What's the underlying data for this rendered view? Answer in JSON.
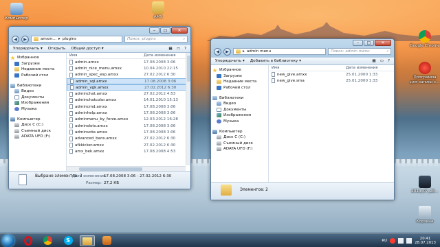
{
  "desktop_icons": [
    {
      "label": "Компьютер"
    },
    {
      "label": "AMX"
    },
    {
      "label": "Google Chrome"
    },
    {
      "label": "Программа для записи с..."
    },
    {
      "label": "2013_07_28..."
    },
    {
      "label": "Корзина"
    }
  ],
  "left_window": {
    "breadcrumb": [
      "amxm...",
      "plugins"
    ],
    "search_placeholder": "Поиск: plugins",
    "toolbar": {
      "organize": "Упорядочить ▾",
      "open": "Открыть",
      "share": "Общий доступ ▾"
    },
    "nav": {
      "favorites": "Избранное",
      "fav_items": [
        "Загрузки",
        "Недавние места",
        "Рабочий стол"
      ],
      "libraries": "Библиотеки",
      "lib_items": [
        "Видео",
        "Документы",
        "Изображения",
        "Музыка"
      ],
      "computer": "Компьютер",
      "pc_items": [
        "Диск C (C:)",
        "Съемный диск",
        "ADATA UFD (F:)"
      ]
    },
    "columns": {
      "name": "Имя",
      "date": "Дата изменения"
    },
    "files": [
      {
        "name": "admin.amxx",
        "date": "17.08.2008 3:06"
      },
      {
        "name": "admin_nice_menu.amxx",
        "date": "10.04.2010 22:15"
      },
      {
        "name": "admin_spec_esp.amxx",
        "date": "27.02.2012 6:30"
      },
      {
        "name": "admin_sql.amxx",
        "date": "17.08.2008 3:06"
      },
      {
        "name": "admin_vgk.amxx",
        "date": "27.02.2012 6:30"
      },
      {
        "name": "adminchat.amxx",
        "date": "27.02.2012 4:53"
      },
      {
        "name": "adminchatcolor.amxx",
        "date": "14.01.2010 15:13"
      },
      {
        "name": "admincmd.amxx",
        "date": "17.08.2008 3:06"
      },
      {
        "name": "adminhelp.amxx",
        "date": "17.08.2008 3:06"
      },
      {
        "name": "adminmenu_by_forze.amxx",
        "date": "12.03.2012 16:28"
      },
      {
        "name": "adminslots.amxx",
        "date": "17.08.2008 3:06"
      },
      {
        "name": "adminvote.amxx",
        "date": "17.08.2008 3:06"
      },
      {
        "name": "advanced_bans.amxx",
        "date": "27.02.2012 6:30"
      },
      {
        "name": "afkkicker.amxx",
        "date": "27.02.2012 6:30"
      },
      {
        "name": "amx_bek.amxx",
        "date": "17.08.2008 4:53"
      }
    ],
    "selected_indices": [
      3,
      4
    ],
    "details": {
      "selected": "Выбрано элементов: 2",
      "date_label": "Дата изменения:",
      "date_value": "17.08.2008 3:06 - 27.02.2012 6:30",
      "size_label": "Размер:",
      "size_value": "27,2 КБ"
    }
  },
  "right_window": {
    "breadcrumb": [
      "admin menu"
    ],
    "search_placeholder": "Поиск: admin menu",
    "toolbar": {
      "organize": "Упорядочить ▾",
      "add_lib": "Добавить в библиотеку ▾"
    },
    "nav": {
      "favorites": "Избранное",
      "fav_items": [
        "Загрузки",
        "Недавние места",
        "Рабочий стол"
      ],
      "libraries": "Библиотеки",
      "lib_items": [
        "Видео",
        "Документы",
        "Изображения",
        "Музыка"
      ],
      "computer": "Компьютер",
      "pc_items": [
        "Диск C (C:)",
        "Съемный диск",
        "ADATA UFD (F:)"
      ]
    },
    "columns": {
      "name": "Имя",
      "date": "Дата изменения"
    },
    "files": [
      {
        "name": "new_give.amxx",
        "date": "25.01.2000 1:33"
      },
      {
        "name": "new_give.sma",
        "date": "25.01.2000 1:33"
      }
    ],
    "details": {
      "count": "Элементов: 2"
    }
  },
  "taskbar": {
    "lang": "RU",
    "time": "20:41",
    "date": "28.07.2013"
  }
}
